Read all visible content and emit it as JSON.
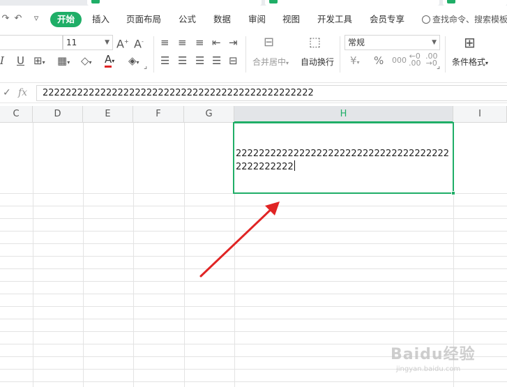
{
  "menu": {
    "items": [
      "开始",
      "插入",
      "页面布局",
      "公式",
      "数据",
      "审阅",
      "视图",
      "开发工具",
      "会员专享"
    ],
    "active_index": 0,
    "search_label": "查找命令、搜索模板"
  },
  "toolbar": {
    "font_size": "11",
    "number_format": "常规",
    "merge_label": "合并居中",
    "wrap_label": "自动换行",
    "conditional_label": "条件格式",
    "currency_symbol": "¥",
    "percent_symbol": "%"
  },
  "formula_bar": {
    "fx_label": "fx",
    "value": "22222222222222222222222222222222222222222222222"
  },
  "columns": [
    "C",
    "D",
    "E",
    "F",
    "G",
    "H",
    "I"
  ],
  "active_column": "H",
  "cell": {
    "text": "22222222222222222222222222222222222222222222222"
  },
  "watermark": {
    "brand": "Baidu经验",
    "url": "jingyan.baidu.com"
  },
  "colors": {
    "accent": "#1fae67",
    "arrow": "#e02424"
  }
}
